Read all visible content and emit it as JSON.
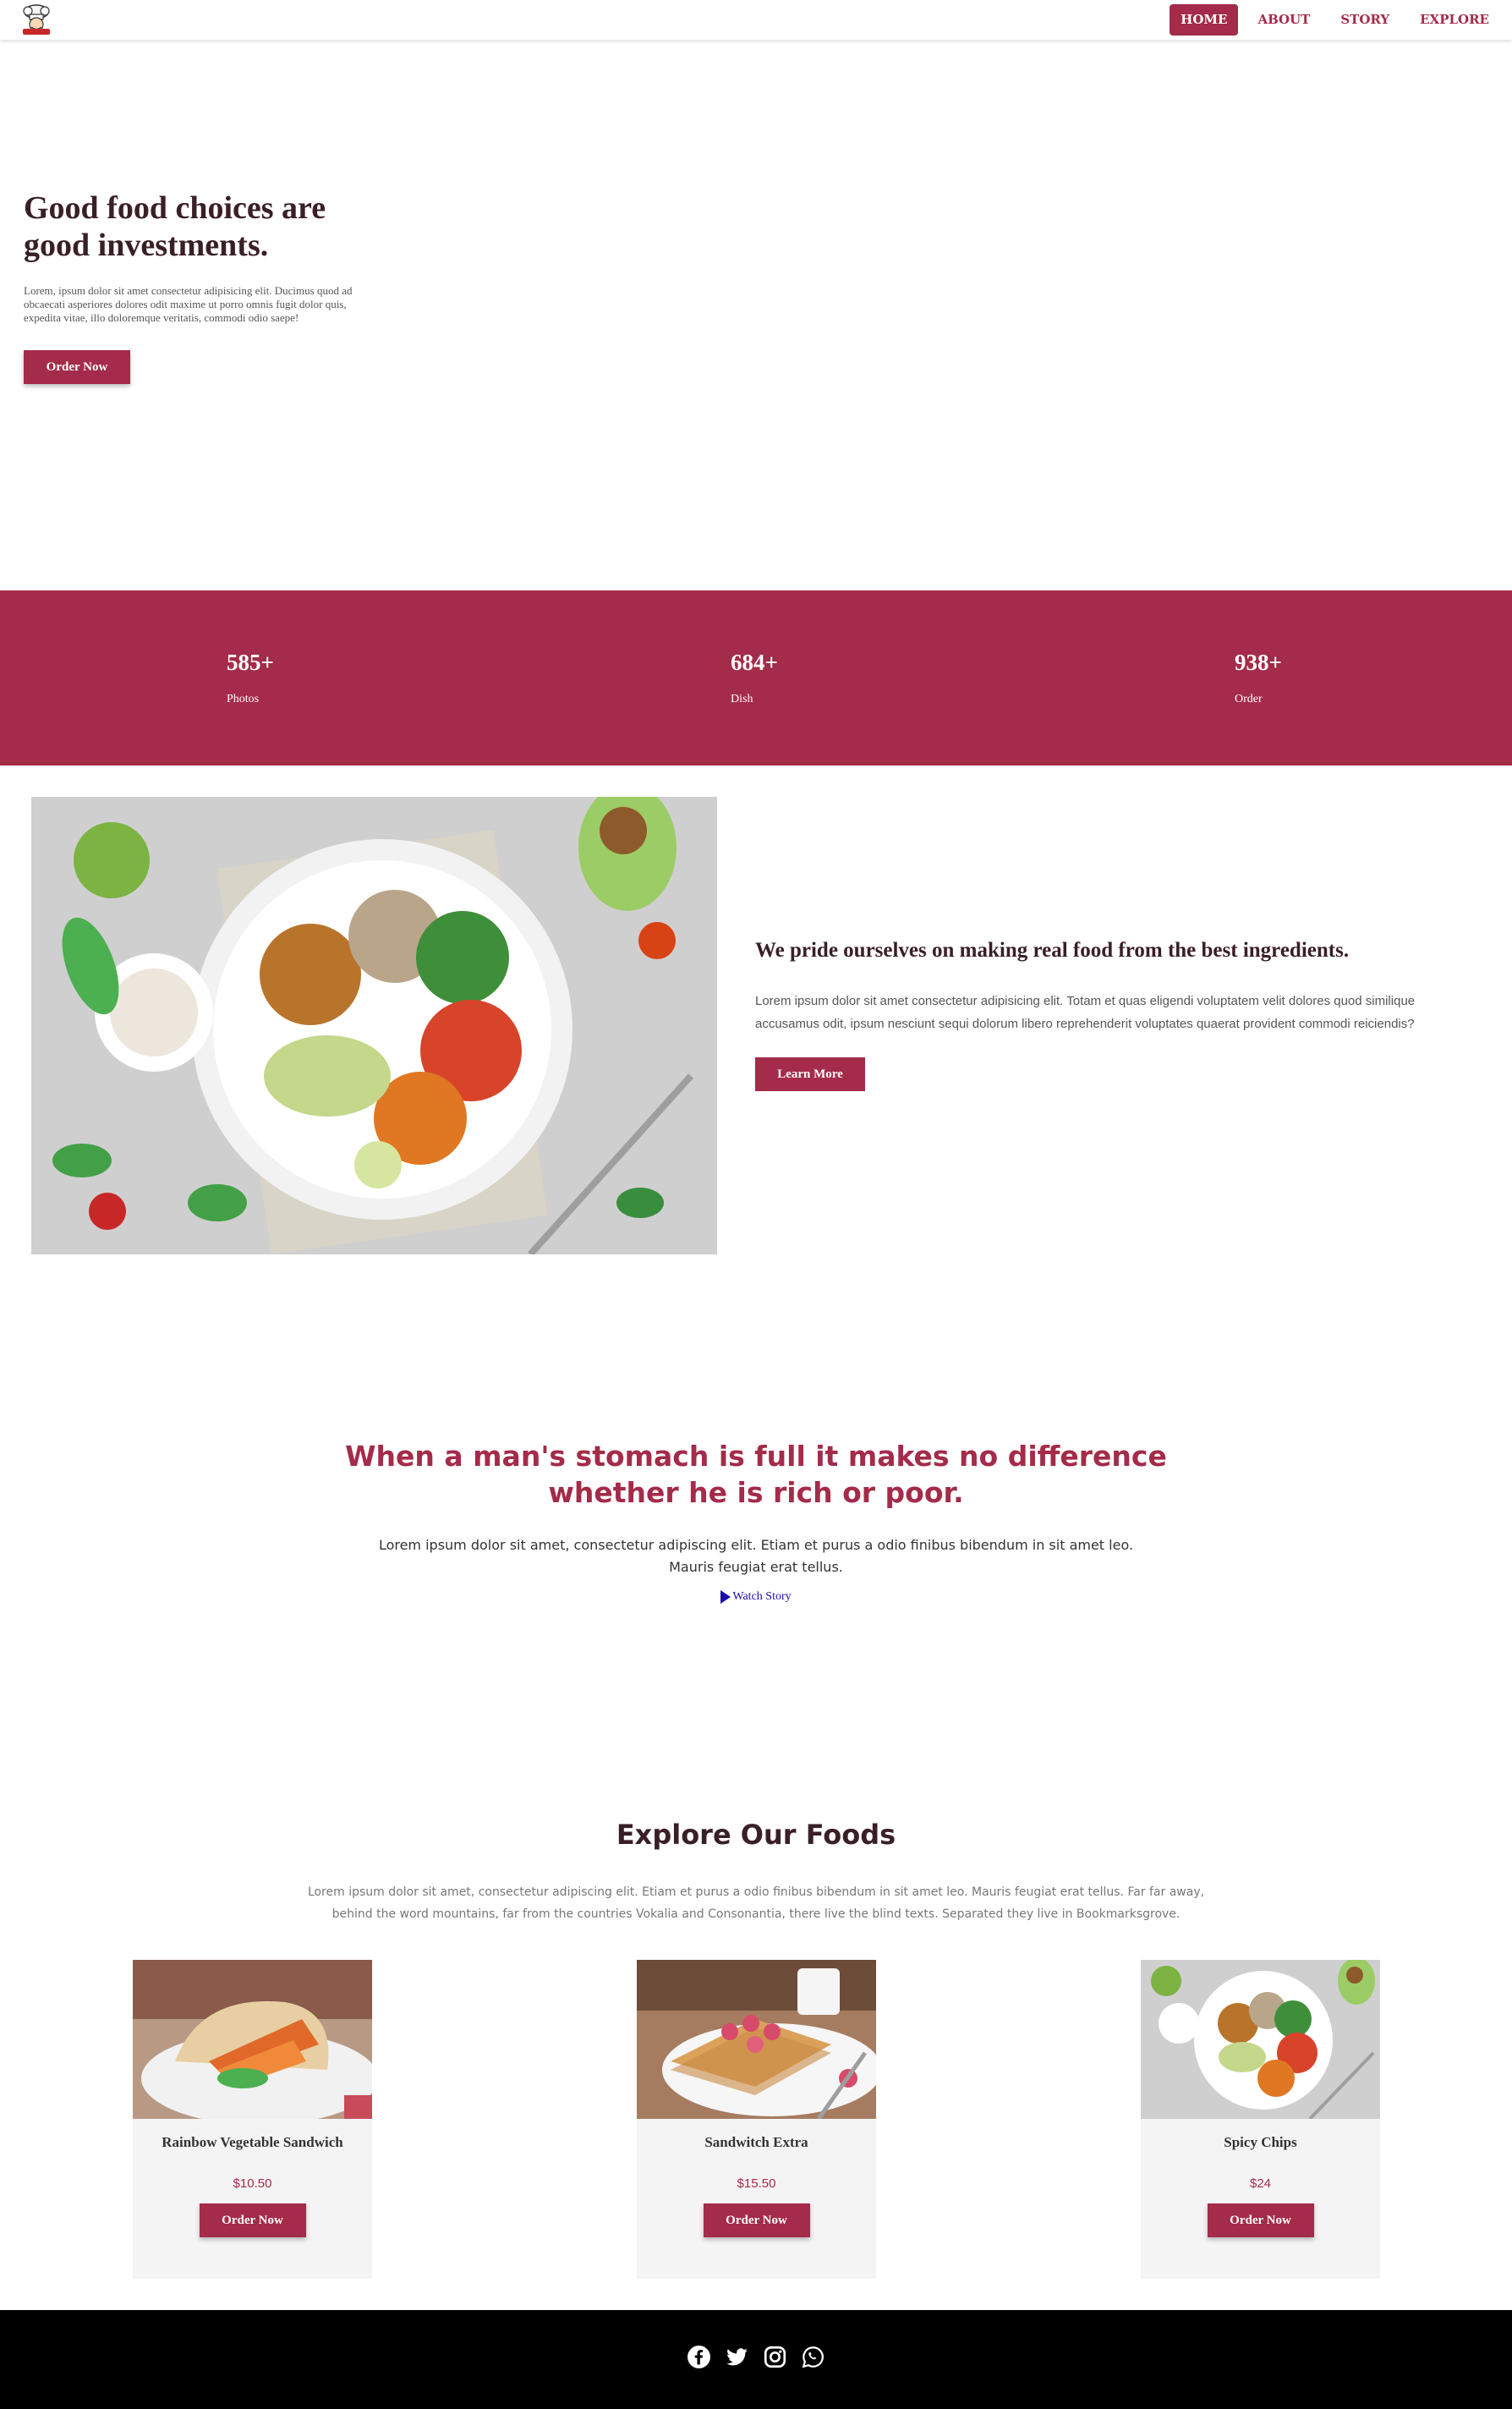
{
  "nav": {
    "items": [
      {
        "label": "HOME",
        "active": true
      },
      {
        "label": "ABOUT",
        "active": false
      },
      {
        "label": "STORY",
        "active": false
      },
      {
        "label": "EXPLORE",
        "active": false
      }
    ]
  },
  "hero": {
    "title": "Good food choices are good investments.",
    "text": "Lorem, ipsum dolor sit amet consectetur adipisicing elit. Ducimus quod ad obcaecati asperiores dolores odit maxime ut porro omnis fugit dolor quis, expedita vitae, illo doloremque veritatis, commodi odio saepe!",
    "button": "Order Now"
  },
  "stats": [
    {
      "value": "585+",
      "label": "Photos"
    },
    {
      "value": "684+",
      "label": "Dish"
    },
    {
      "value": "938+",
      "label": "Order"
    }
  ],
  "about": {
    "title": "We pride ourselves on making real food from the best ingredients.",
    "text": "Lorem ipsum dolor sit amet consectetur adipisicing elit. Totam et quas eligendi voluptatem velit dolores quod similique accusamus odit, ipsum nesciunt sequi dolorum libero reprehenderit voluptates quaerat provident commodi reiciendis?",
    "button": "Learn More"
  },
  "quote": {
    "title": "When a man's stomach is full it makes no difference whether he is rich or poor.",
    "text": "Lorem ipsum dolor sit amet, consectetur adipiscing elit. Etiam et purus a odio finibus bibendum in sit amet leo. Mauris feugiat erat tellus.",
    "link": "Watch Story"
  },
  "explore": {
    "title": "Explore Our Foods",
    "text": "Lorem ipsum dolor sit amet, consectetur adipiscing elit. Etiam et purus a odio finibus bibendum in sit amet leo. Mauris feugiat erat tellus. Far far away, behind the word mountains, far from the countries Vokalia and Consonantia, there live the blind texts. Separated they live in Bookmarksgrove.",
    "cards": [
      {
        "name": "Rainbow Vegetable Sandwich",
        "price": "$10.50",
        "button": "Order Now"
      },
      {
        "name": "Sandwitch Extra",
        "price": "$15.50",
        "button": "Order Now"
      },
      {
        "name": "Spicy Chips",
        "price": "$24",
        "button": "Order Now"
      }
    ]
  },
  "colors": {
    "accent": "#a42b49",
    "dark": "#3a1f26",
    "footer": "#000000"
  },
  "icons": [
    "chef-logo-icon",
    "play-icon",
    "facebook-icon",
    "twitter-icon",
    "instagram-icon",
    "whatsapp-icon"
  ]
}
